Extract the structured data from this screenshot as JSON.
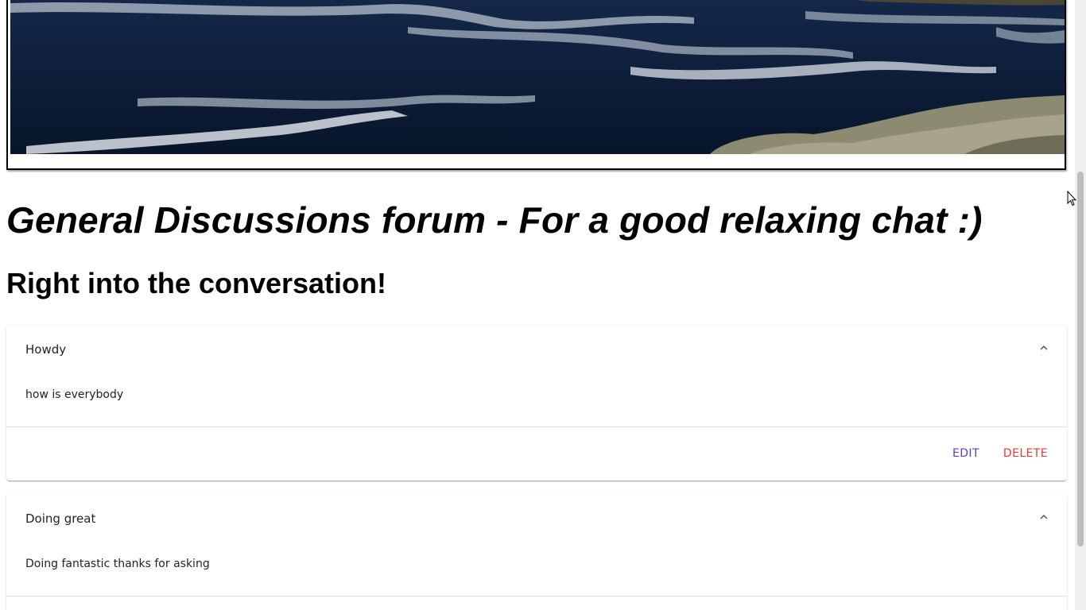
{
  "banner": {
    "image_alt": "ocean waves and rocky shore"
  },
  "page": {
    "title": "General Discussions forum - For a good relaxing chat :)",
    "subtitle": "Right into the conversation!"
  },
  "posts": [
    {
      "title": "Howdy",
      "body": "how is everybody",
      "edit_label": "EDIT",
      "delete_label": "DELETE"
    },
    {
      "title": "Doing great",
      "body": "Doing fantastic thanks for asking"
    }
  ],
  "colors": {
    "edit": "#5b3fc4",
    "delete": "#e53935"
  },
  "icons": {
    "collapse": "chevron-up-icon"
  }
}
